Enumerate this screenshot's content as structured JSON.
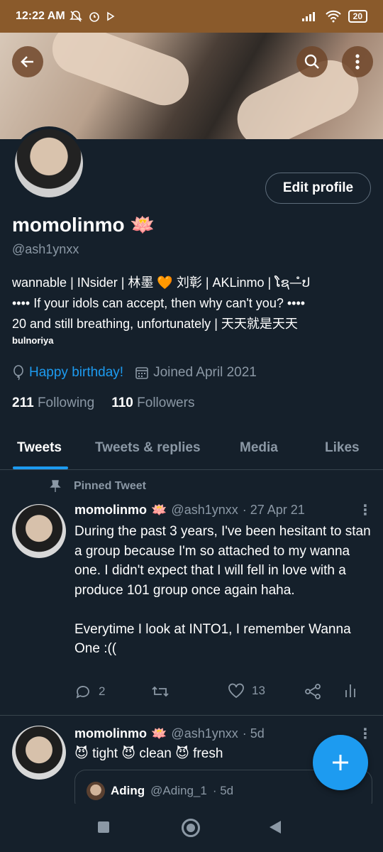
{
  "status_bar": {
    "time": "12:22 AM",
    "left_icons": [
      "mute-icon",
      "alarm-icon",
      "play-icon"
    ],
    "battery": "20"
  },
  "profile": {
    "name": "momolinmo",
    "name_emoji": "🪷",
    "handle": "@ash1ynxx",
    "edit_label": "Edit profile",
    "bio_lines": [
      "wannable | INsider | 林墨 🧡 刘彰 | AKLinmo | ໂຊ—ໍປ",
      "•••• If your idols can accept, then why can't you? ••••",
      "20 and still breathing, unfortunately | 天天就是天天"
    ],
    "bio_small": "bulnoriya",
    "birthday": "Happy birthday!",
    "joined": "Joined April 2021",
    "following_count": "211",
    "following_label": "Following",
    "followers_count": "110",
    "followers_label": "Followers"
  },
  "tabs": [
    "Tweets",
    "Tweets & replies",
    "Media",
    "Likes"
  ],
  "pinned_label": "Pinned Tweet",
  "tweets": [
    {
      "name": "momolinmo",
      "emoji": "🪷",
      "handle": "@ash1ynxx",
      "time": "· 27 Apr 21",
      "text": "During the past 3 years, I've been hesitant to stan a group because I'm so attached to my wanna one. I didn't expect that I will fell in love with a produce 101 group once again haha.\n\nEverytime I look at INTO1, I remember Wanna One :((",
      "replies": "2",
      "likes": "13"
    },
    {
      "name": "momolinmo",
      "emoji": "🪷",
      "handle": "@ash1ynxx",
      "time": "· 5d",
      "text": "😈 tight 😈 clean 😈 fresh",
      "quote": {
        "name": "Ading",
        "handle": "@Ading_1",
        "time": "· 5d"
      }
    }
  ],
  "colors": {
    "background": "#15202b",
    "accent": "#1d9bf0",
    "muted": "#8b98a5",
    "status_bar": "#8a5a2b"
  }
}
